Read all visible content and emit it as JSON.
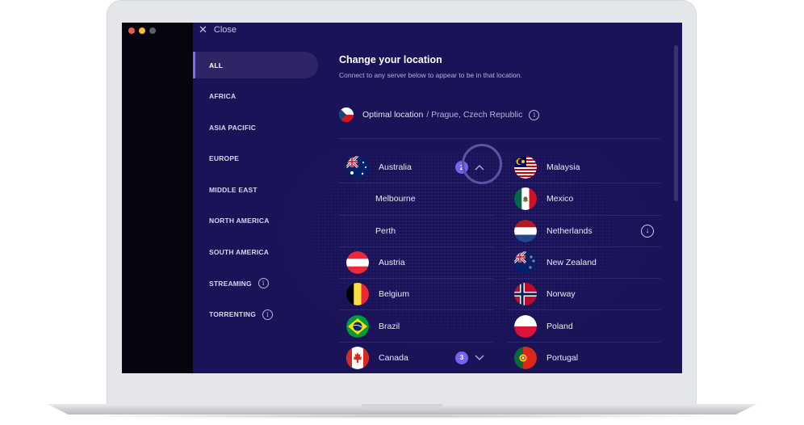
{
  "window": {
    "close_label": "Close",
    "close_icon": "x"
  },
  "sidebar": {
    "items": [
      {
        "label": "ALL",
        "active": true
      },
      {
        "label": "AFRICA"
      },
      {
        "label": "ASIA PACIFIC"
      },
      {
        "label": "EUROPE"
      },
      {
        "label": "MIDDLE EAST"
      },
      {
        "label": "NORTH AMERICA"
      },
      {
        "label": "SOUTH AMERICA"
      },
      {
        "label": "STREAMING",
        "info": true
      },
      {
        "label": "TORRENTING",
        "info": true
      }
    ],
    "info_glyph": "i"
  },
  "header": {
    "title": "Change your location",
    "subtitle": "Connect to any server below to appear to be in that location."
  },
  "optimal": {
    "label": "Optimal location",
    "location": "/ Prague, Czech Republic",
    "flag": "czech-republic"
  },
  "locations_left": [
    {
      "name": "Australia",
      "flag": "australia",
      "badge": "2",
      "expanded": true,
      "chevron": "^"
    },
    {
      "name": "Melbourne",
      "sub": true
    },
    {
      "name": "Perth",
      "sub": true
    },
    {
      "name": "Austria",
      "flag": "austria"
    },
    {
      "name": "Belgium",
      "flag": "belgium"
    },
    {
      "name": "Brazil",
      "flag": "brazil"
    },
    {
      "name": "Canada",
      "flag": "canada",
      "badge": "3",
      "chevron": "v"
    }
  ],
  "locations_right": [
    {
      "name": "Malaysia",
      "flag": "malaysia"
    },
    {
      "name": "Mexico",
      "flag": "mexico"
    },
    {
      "name": "Netherlands",
      "flag": "netherlands",
      "download": true,
      "download_glyph": "↓"
    },
    {
      "name": "New Zealand",
      "flag": "new-zealand"
    },
    {
      "name": "Norway",
      "flag": "norway"
    },
    {
      "name": "Poland",
      "flag": "poland"
    },
    {
      "name": "Portugal",
      "flag": "portugal"
    }
  ],
  "colors": {
    "background": "#1a1358",
    "accent": "#7463f0",
    "active_nav": "#2d2565"
  }
}
